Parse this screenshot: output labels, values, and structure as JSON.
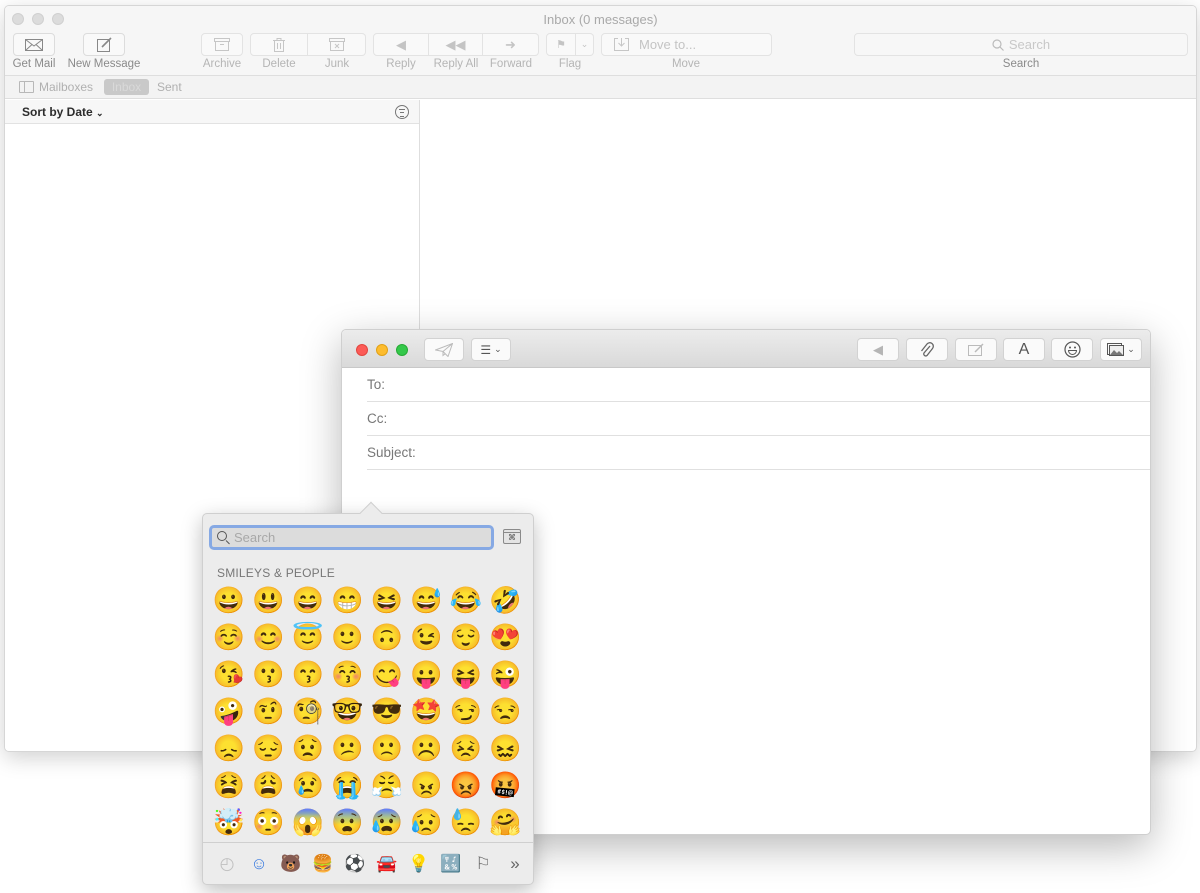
{
  "main_window": {
    "title": "Inbox (0 messages)",
    "toolbar": {
      "get_mail": "Get Mail",
      "new_message": "New Message",
      "archive": "Archive",
      "delete": "Delete",
      "junk": "Junk",
      "reply": "Reply",
      "reply_all": "Reply All",
      "forward": "Forward",
      "flag": "Flag",
      "move_to": "Move to...",
      "move": "Move",
      "search_placeholder": "Search",
      "search_label": "Search"
    },
    "favorites": {
      "mailboxes": "Mailboxes",
      "inbox": "Inbox",
      "sent": "Sent"
    },
    "sort_label": "Sort by Date"
  },
  "compose": {
    "fields": {
      "to": "To:",
      "cc": "Cc:",
      "subject": "Subject:"
    },
    "format_button": "A"
  },
  "emoji_picker": {
    "search_placeholder": "Search",
    "keyboard_viewer_glyph": "⌘",
    "category_title": "SMILEYS & PEOPLE",
    "emojis": [
      "😀",
      "😃",
      "😄",
      "😁",
      "😆",
      "😅",
      "😂",
      "🤣",
      "☺️",
      "😊",
      "😇",
      "🙂",
      "🙃",
      "😉",
      "😌",
      "😍",
      "😘",
      "😗",
      "😙",
      "😚",
      "😋",
      "😛",
      "😝",
      "😜",
      "🤪",
      "🤨",
      "🧐",
      "🤓",
      "😎",
      "🤩",
      "😏",
      "😒",
      "😞",
      "😔",
      "😟",
      "😕",
      "🙁",
      "☹️",
      "😣",
      "😖",
      "😫",
      "😩",
      "😢",
      "😭",
      "😤",
      "😠",
      "😡",
      "🤬",
      "🤯",
      "😳",
      "😱",
      "😨",
      "😰",
      "😥",
      "😓",
      "🤗"
    ],
    "categories": [
      {
        "name": "recent",
        "glyph": "◴"
      },
      {
        "name": "smileys-people",
        "glyph": "☺"
      },
      {
        "name": "animals-nature",
        "glyph": "🐻"
      },
      {
        "name": "food-drink",
        "glyph": "🍔"
      },
      {
        "name": "activity",
        "glyph": "⚽"
      },
      {
        "name": "travel-places",
        "glyph": "🚘"
      },
      {
        "name": "objects",
        "glyph": "💡"
      },
      {
        "name": "symbols",
        "glyph": "🔣"
      },
      {
        "name": "flags",
        "glyph": "⚐"
      },
      {
        "name": "more",
        "glyph": "»"
      }
    ]
  }
}
